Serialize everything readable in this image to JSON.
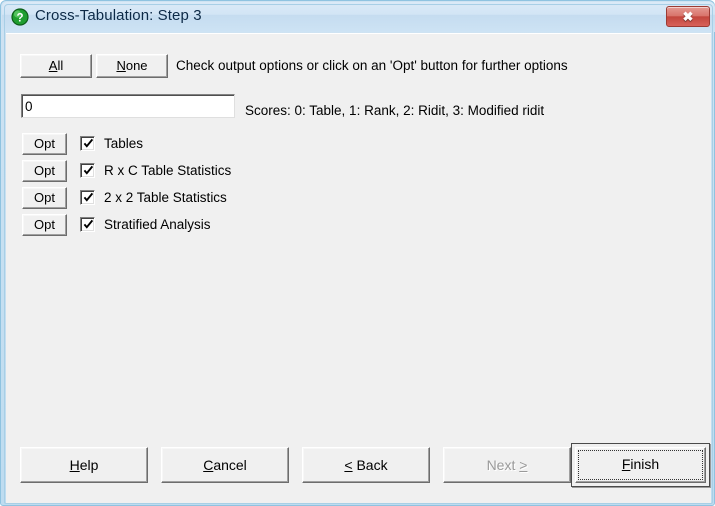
{
  "window": {
    "title": "Cross-Tabulation: Step 3",
    "title_icon": "green-question-mark-icon",
    "close_label": "✖",
    "accent_title_color": "#0d2a47",
    "close_button_color": "#c2453c",
    "frame_color": "#bedcf0",
    "client_background": "#f0f0f0"
  },
  "toolbar": {
    "all_label": "All",
    "all_accel": "A",
    "none_label": "None",
    "none_accel": "N",
    "instruction": "Check output options or click on an 'Opt' button for further options"
  },
  "scores": {
    "value": "0",
    "placeholder": "",
    "legend": "Scores: 0: Table, 1: Rank, 2: Ridit, 3: Modified ridit"
  },
  "options": {
    "opt_button_label": "Opt",
    "rows": [
      {
        "label": "Tables",
        "checked": true
      },
      {
        "label": "R x C Table Statistics",
        "checked": true
      },
      {
        "label": "2 x 2 Table Statistics",
        "checked": true
      },
      {
        "label": "Stratified Analysis",
        "checked": true
      }
    ]
  },
  "footer": {
    "help": {
      "label": "Help",
      "accel": "H",
      "enabled": true,
      "default": false
    },
    "cancel": {
      "label": "Cancel",
      "accel": "C",
      "enabled": true,
      "default": false
    },
    "back": {
      "label": "< Back",
      "accel": "B",
      "enabled": true,
      "default": false
    },
    "next": {
      "label": "Next >",
      "accel": "N",
      "enabled": false,
      "default": false
    },
    "finish": {
      "label": "Finish",
      "accel": "F",
      "enabled": true,
      "default": true
    }
  }
}
